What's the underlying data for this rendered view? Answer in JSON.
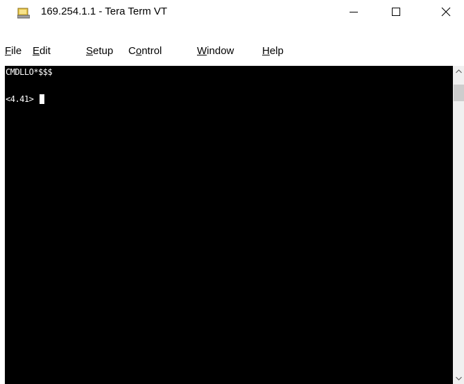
{
  "window": {
    "title": "169.254.1.1 - Tera Term VT",
    "icon": "tera-term-app-icon",
    "controls": {
      "minimize_icon": "minimize-icon",
      "maximize_icon": "maximize-icon",
      "close_icon": "close-icon"
    }
  },
  "menu": {
    "items": [
      {
        "accel": "F",
        "rest": "ile"
      },
      {
        "accel": "E",
        "rest": "dit"
      },
      {
        "accel": "S",
        "rest": "etup"
      },
      {
        "pre": "C",
        "accel": "o",
        "rest": "ntrol"
      },
      {
        "accel": "W",
        "rest": "indow"
      },
      {
        "accel": "H",
        "rest": "elp"
      }
    ]
  },
  "terminal": {
    "background": "#000000",
    "foreground": "#ffffff",
    "lines": [
      "CMDLLO*$$$",
      "<4.41> "
    ]
  },
  "scrollbar": {
    "up_icon": "scroll-up-arrow-icon",
    "down_icon": "scroll-down-arrow-icon"
  }
}
